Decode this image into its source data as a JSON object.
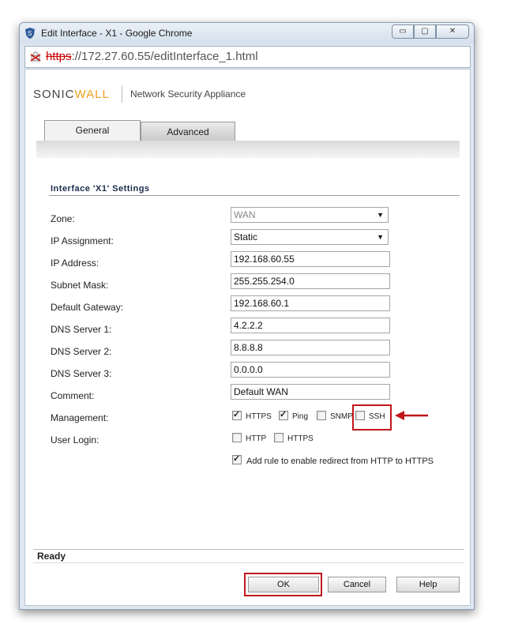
{
  "window": {
    "title": "Edit Interface - X1 - Google Chrome",
    "controls": {
      "minimize": "▭",
      "restore": "▢",
      "close": "✕"
    }
  },
  "address_bar": {
    "scheme": "https",
    "rest": "://172.27.60.55/editInterface_1.html"
  },
  "brand": {
    "name_part1": "SONIC",
    "name_part2": "WALL",
    "subtitle": "Network Security Appliance"
  },
  "tabs": [
    {
      "label": "General"
    },
    {
      "label": "Advanced"
    }
  ],
  "section_title": "Interface 'X1' Settings",
  "form": {
    "zone": {
      "label": "Zone:",
      "value": "WAN"
    },
    "ip_assignment": {
      "label": "IP Assignment:",
      "value": "Static"
    },
    "ip_address": {
      "label": "IP Address:",
      "value": "192.168.60.55"
    },
    "subnet_mask": {
      "label": "Subnet Mask:",
      "value": "255.255.254.0"
    },
    "default_gateway": {
      "label": "Default Gateway:",
      "value": "192.168.60.1"
    },
    "dns1": {
      "label": "DNS Server 1:",
      "value": "4.2.2.2"
    },
    "dns2": {
      "label": "DNS Server 2:",
      "value": "8.8.8.8"
    },
    "dns3": {
      "label": "DNS Server 3:",
      "value": "0.0.0.0"
    },
    "comment": {
      "label": "Comment:",
      "value": "Default WAN"
    },
    "management": {
      "label": "Management:",
      "options": [
        {
          "label": "HTTPS",
          "checked": true
        },
        {
          "label": "Ping",
          "checked": true
        },
        {
          "label": "SNMP",
          "checked": false
        },
        {
          "label": "SSH",
          "checked": false
        }
      ]
    },
    "user_login": {
      "label": "User Login:",
      "options": [
        {
          "label": "HTTP",
          "checked": false
        },
        {
          "label": "HTTPS",
          "checked": false
        }
      ]
    },
    "redirect": {
      "label": "Add rule to enable redirect from HTTP to HTTPS",
      "checked": true
    }
  },
  "status": "Ready",
  "buttons": {
    "ok": "OK",
    "cancel": "Cancel",
    "help": "Help"
  },
  "colors": {
    "highlight": "#c0161b",
    "brand_accent": "#f0a020"
  }
}
